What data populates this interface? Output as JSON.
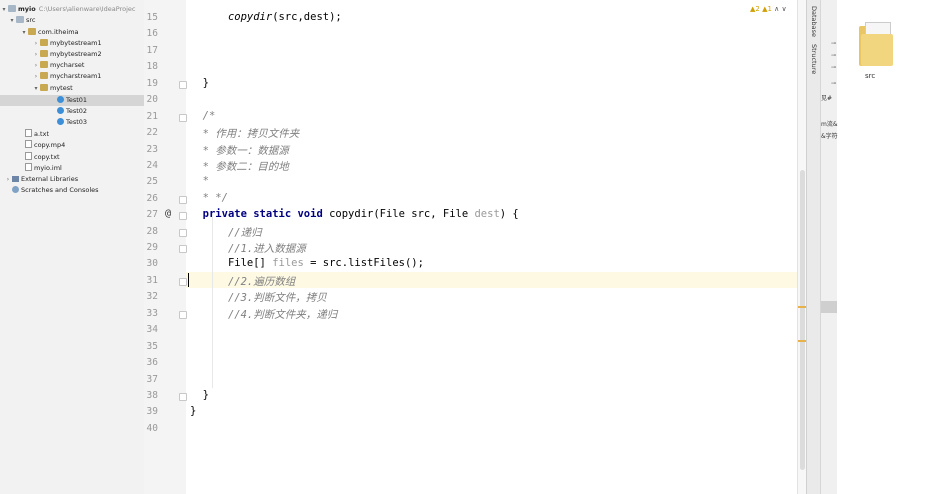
{
  "project_tree": {
    "root": {
      "name": "myio",
      "path": "C:\\Users\\alienware\\IdeaProjec"
    },
    "items": [
      {
        "label": "src"
      },
      {
        "label": "com.itheima"
      },
      {
        "label": "mybytestream1"
      },
      {
        "label": "mybytestream2"
      },
      {
        "label": "mycharset"
      },
      {
        "label": "mycharstream1"
      },
      {
        "label": "mytest"
      },
      {
        "label": "Test01"
      },
      {
        "label": "Test02"
      },
      {
        "label": "Test03"
      },
      {
        "label": "a.txt"
      },
      {
        "label": "copy.mp4"
      },
      {
        "label": "copy.txt"
      },
      {
        "label": "myio.iml"
      },
      {
        "label": "External Libraries"
      },
      {
        "label": "Scratches and Consoles"
      }
    ]
  },
  "editor": {
    "inspections": {
      "warnings": "▲2",
      "weak": "▲1",
      "up": "∧",
      "down": "∨"
    },
    "line_numbers": [
      "15",
      "16",
      "17",
      "18",
      "19",
      "20",
      "21",
      "22",
      "23",
      "24",
      "25",
      "26",
      "27",
      "28",
      "29",
      "30",
      "31",
      "32",
      "33",
      "34",
      "35",
      "36",
      "37",
      "38",
      "39",
      "40"
    ],
    "gutter_marker": "@",
    "code": {
      "l15a": "copydir",
      "l15b": "(src,dest);",
      "l19": "}",
      "l21": "/*",
      "l22": "* 作用：拷贝文件夹",
      "l23": "* 参数一：数据源",
      "l24": "* 参数二：目的地",
      "l25": "*",
      "l26": "* */",
      "l27_kw": "private static void",
      "l27_name": " copydir(File src, File ",
      "l27_unused": "dest",
      "l27_end": ") {",
      "l28": "//递归",
      "l29": "//1.进入数据源",
      "l30a": "File[] ",
      "l30_unused": "files",
      "l30b": " = src.listFiles();",
      "l31": "//2.遍历数组",
      "l32": "//3.判断文件，拷贝",
      "l33": "//4.判断文件夹，递归",
      "l38": "}",
      "l39": "}"
    }
  },
  "right_tools": {
    "database": "Database",
    "structure": "Structure"
  },
  "explorer": {
    "folder_label": "src",
    "side_texts": [
      "见#",
      "m流&",
      "&字符"
    ]
  }
}
